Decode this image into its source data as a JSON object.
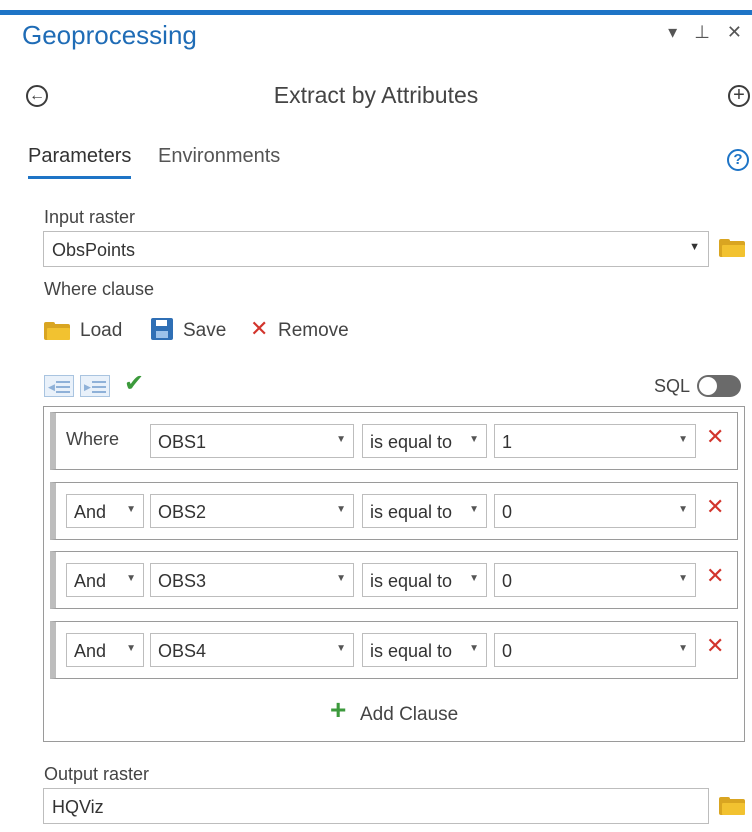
{
  "pane": {
    "title": "Geoprocessing",
    "controls": {
      "menu": "▾",
      "pin": "⊥",
      "close": "✕"
    }
  },
  "tool": {
    "title": "Extract by Attributes",
    "back_icon": "back-circle-arrow",
    "add_icon": "plus-circle"
  },
  "tabs": [
    {
      "label": "Parameters",
      "active": true
    },
    {
      "label": "Environments",
      "active": false
    }
  ],
  "help_label": "?",
  "input_raster": {
    "label": "Input raster",
    "value": "ObsPoints"
  },
  "where_clause": {
    "label": "Where clause",
    "load_label": "Load",
    "save_label": "Save",
    "remove_label": "Remove",
    "sql_label": "SQL",
    "sql_enabled": false,
    "check_icon": "✔",
    "rows": [
      {
        "connector": "Where",
        "field": "OBS1",
        "operator": "is equal to",
        "value": "1"
      },
      {
        "connector": "And",
        "field": "OBS2",
        "operator": "is equal to",
        "value": "0"
      },
      {
        "connector": "And",
        "field": "OBS3",
        "operator": "is equal to",
        "value": "0"
      },
      {
        "connector": "And",
        "field": "OBS4",
        "operator": "is equal to",
        "value": "0"
      }
    ],
    "add_clause_label": "Add Clause"
  },
  "output_raster": {
    "label": "Output raster",
    "value": "HQViz"
  },
  "colors": {
    "accent": "#1e74c6",
    "delete": "#d2342c",
    "ok": "#3c9a3c",
    "folder": "#f2c230"
  }
}
